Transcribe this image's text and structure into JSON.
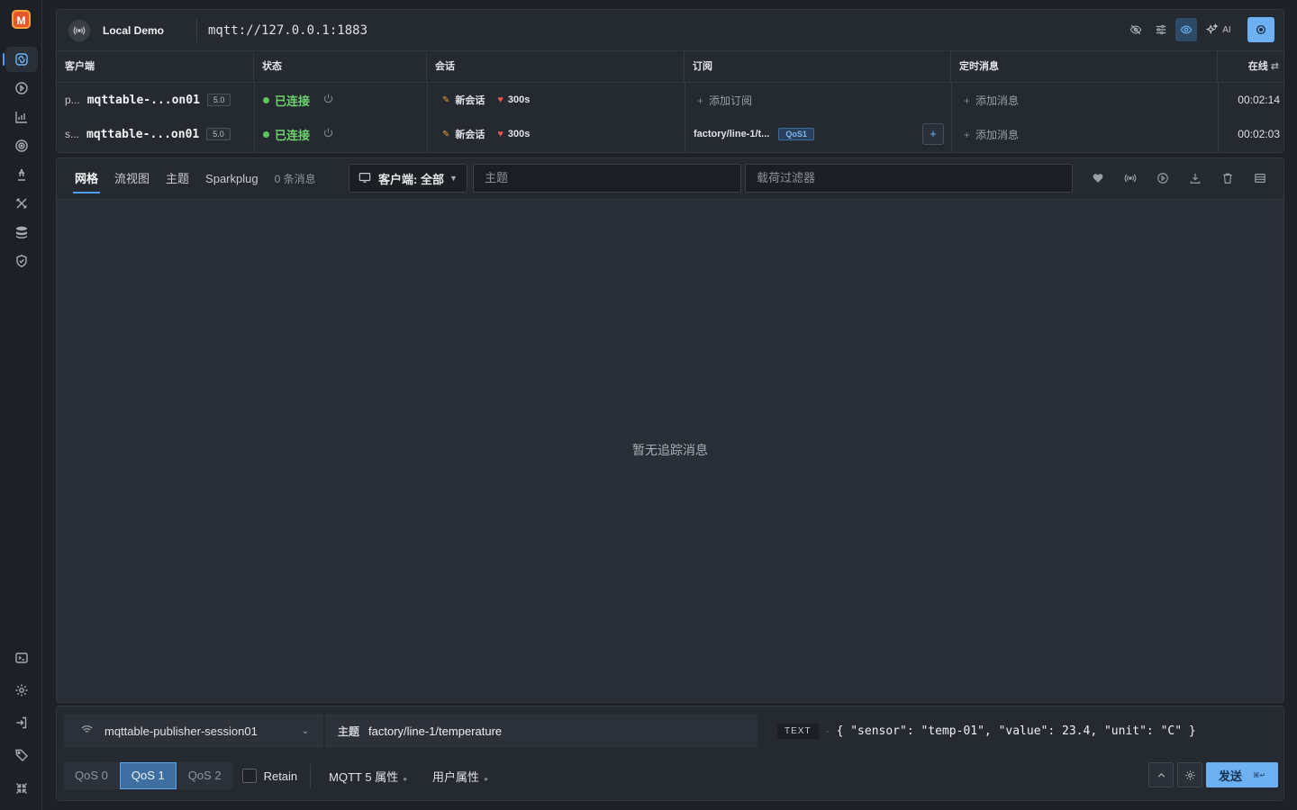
{
  "app": {
    "logo": "M"
  },
  "sidebar": {
    "items": [
      {
        "icon": "connections-icon",
        "active": true
      },
      {
        "icon": "play-circle-icon"
      },
      {
        "icon": "chart-icon"
      },
      {
        "icon": "target-icon"
      },
      {
        "icon": "publish-icon"
      },
      {
        "icon": "tools-icon"
      },
      {
        "icon": "database-icon"
      },
      {
        "icon": "shield-icon"
      }
    ],
    "bottom": [
      {
        "icon": "terminal-icon"
      },
      {
        "icon": "settings-icon"
      },
      {
        "icon": "login-icon"
      },
      {
        "icon": "tag-icon"
      },
      {
        "icon": "collapse-icon"
      }
    ]
  },
  "connection": {
    "name": "Local Demo",
    "url": "mqtt://127.0.0.1:1883",
    "toolbar": {
      "ai_label": "AI"
    }
  },
  "table": {
    "headers": {
      "client": "客户端",
      "status": "状态",
      "session": "会话",
      "subscriptions": "订阅",
      "scheduled": "定时消息",
      "online": "在线"
    },
    "rows": [
      {
        "prefix": "p...",
        "client": "mqttable-...on01",
        "version": "5.0",
        "status": "已连接",
        "session": "新会话",
        "keepalive": "300s",
        "subscription": "添加订阅",
        "scheduled": "添加消息",
        "online_time": "00:02:14"
      },
      {
        "prefix": "s...",
        "client": "mqttable-...on01",
        "version": "5.0",
        "status": "已连接",
        "session": "新会话",
        "keepalive": "300s",
        "sub_topic": "factory/line-1/t...",
        "sub_qos": "QoS1",
        "scheduled": "添加消息",
        "online_time": "00:02:03"
      }
    ]
  },
  "messages": {
    "tabs": [
      "网格",
      "流视图",
      "主题",
      "Sparkplug"
    ],
    "active_tab": "网格",
    "count": "0 条消息",
    "client_filter": "客户端: 全部",
    "topic_placeholder": "主题",
    "payload_placeholder": "载荷过滤器",
    "empty": "暂无追踪消息"
  },
  "composer": {
    "session": "mqttable-publisher-session01",
    "topic_label": "主题",
    "topic": "factory/line-1/temperature",
    "format": "TEXT",
    "payload": "{ \"sensor\": \"temp-01\", \"value\": 23.4, \"unit\": \"C\" }",
    "qos": [
      "QoS 0",
      "QoS 1",
      "QoS 2"
    ],
    "selected_qos": "QoS 1",
    "retain": "Retain",
    "mqtt5_props": "MQTT 5 属性",
    "user_props": "用户属性",
    "send": "发送",
    "send_shortcut": "⌘↵"
  },
  "colors": {
    "accent": "#6eb1f3",
    "connected": "#6fd06f",
    "background": "#1e2127"
  }
}
